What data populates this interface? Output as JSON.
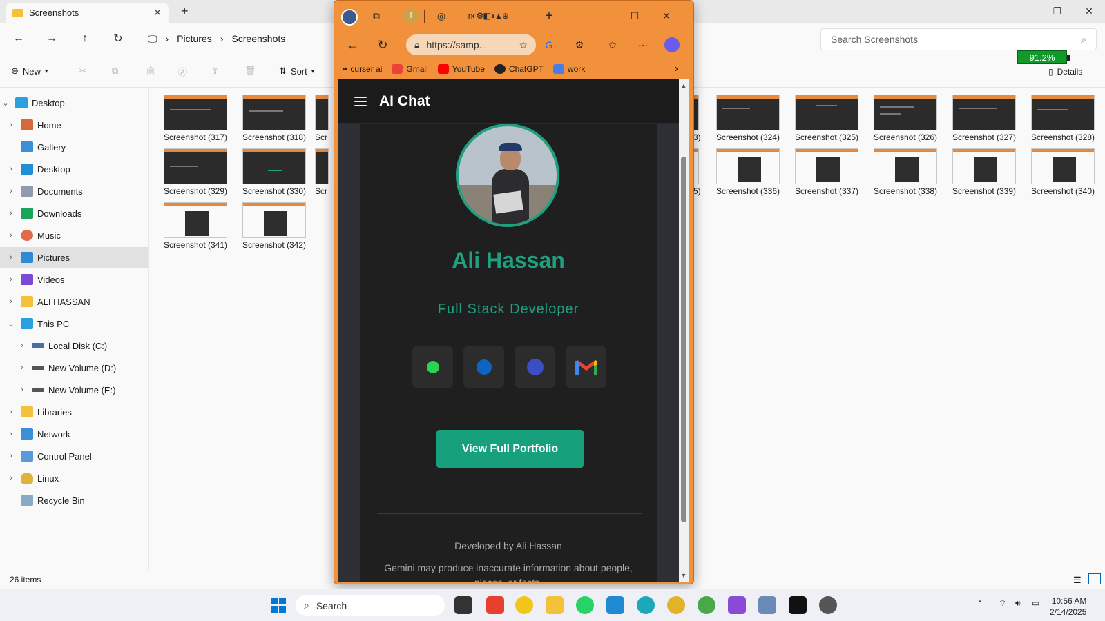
{
  "explorer": {
    "tab_title": "Screenshots",
    "breadcrumb": [
      "Pictures",
      "Screenshots"
    ],
    "search_placeholder": "Search Screenshots",
    "toolbar": {
      "new_label": "New",
      "sort_label": "Sort",
      "details_label": "Details"
    },
    "battery_text": "91.2%",
    "sidebar": [
      {
        "label": "Desktop",
        "expanded": true
      },
      {
        "label": "Home"
      },
      {
        "label": "Gallery"
      },
      {
        "label": "Desktop"
      },
      {
        "label": "Documents"
      },
      {
        "label": "Downloads"
      },
      {
        "label": "Music"
      },
      {
        "label": "Pictures",
        "selected": true
      },
      {
        "label": "Videos"
      },
      {
        "label": "ALI HASSAN"
      },
      {
        "label": "This PC",
        "expanded": true
      },
      {
        "label": "Local Disk (C:)"
      },
      {
        "label": "New Volume (D:)"
      },
      {
        "label": "New Volume (E:)"
      },
      {
        "label": "Libraries"
      },
      {
        "label": "Network"
      },
      {
        "label": "Control Panel"
      },
      {
        "label": "Linux"
      },
      {
        "label": "Recycle Bin"
      }
    ],
    "files_row1_left": [
      "Screenshot (317)",
      "Screenshot (318)",
      "Scr"
    ],
    "files_row1_right": [
      "3)",
      "Screenshot (324)",
      "Screenshot (325)",
      "Screenshot (326)",
      "Screenshot (327)",
      "Screenshot (328)"
    ],
    "files_row2_left": [
      "Screenshot (329)",
      "Screenshot (330)",
      "Scr"
    ],
    "files_row2_right": [
      "5)",
      "Screenshot (336)",
      "Screenshot (337)",
      "Screenshot (338)",
      "Screenshot (339)",
      "Screenshot (340)"
    ],
    "files_row3_left": [
      "Screenshot (341)",
      "Screenshot (342)"
    ],
    "status_text": "26 items"
  },
  "browser": {
    "url": "https://samp...",
    "bookmarks": [
      "curser ai",
      "Gmail",
      "YouTube",
      "ChatGPT",
      "work"
    ],
    "page": {
      "app_title": "AI Chat",
      "name": "Ali Hassan",
      "role": "Full Stack Developer",
      "portfolio_button": "View Full Portfolio",
      "credit": "Developed by Ali Hassan",
      "disclaimer": "Gemini may produce inaccurate information about people, places, or facts."
    }
  },
  "taskbar": {
    "search_label": "Search",
    "time": "10:56 AM",
    "date": "2/14/2025"
  },
  "colors": {
    "accent": "#1fa07f",
    "browser_frame": "#f1913b",
    "page_bg": "#1e1e1e"
  }
}
